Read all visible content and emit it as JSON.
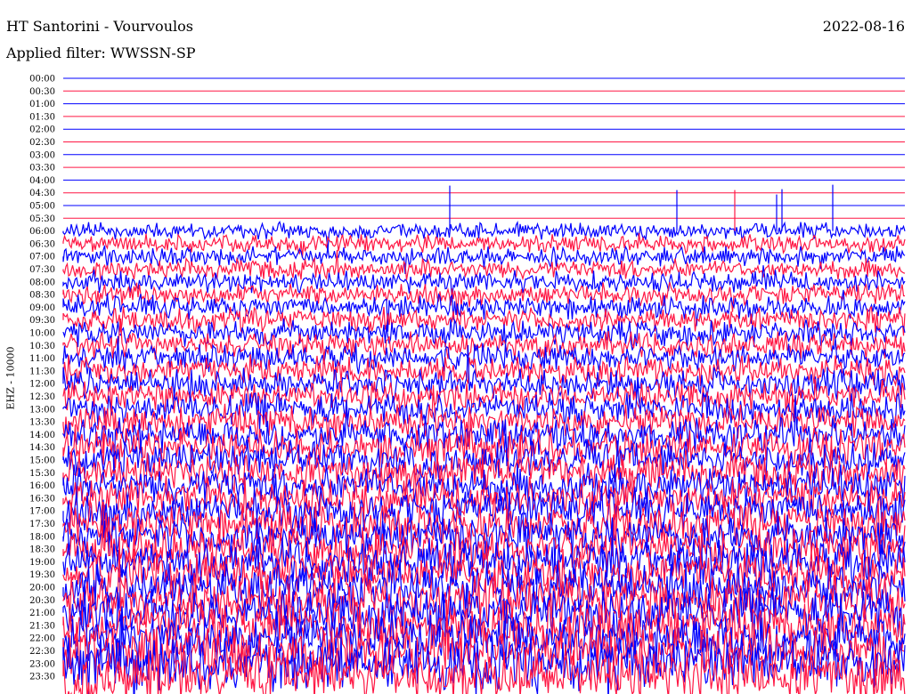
{
  "header": {
    "station": "HT Santorini - Vourvoulos",
    "date": "2022-08-16",
    "filter": "Applied filter: WWSSN-SP"
  },
  "chart_data": {
    "type": "line",
    "title": "HT Santorini - Vourvoulos",
    "ylabel": "EHZ - 10000",
    "row_labels": [
      "00:00",
      "00:30",
      "01:00",
      "01:30",
      "02:00",
      "02:30",
      "03:00",
      "03:30",
      "04:00",
      "04:30",
      "05:00",
      "05:30",
      "06:00",
      "06:30",
      "07:00",
      "07:30",
      "08:00",
      "08:30",
      "09:00",
      "09:30",
      "10:00",
      "10:30",
      "11:00",
      "11:30",
      "12:00",
      "12:30",
      "13:00",
      "13:30",
      "14:00",
      "14:30",
      "15:00",
      "15:30",
      "16:00",
      "16:30",
      "17:00",
      "17:30",
      "18:00",
      "18:30",
      "19:00",
      "19:30",
      "20:00",
      "20:30",
      "21:00",
      "21:30",
      "22:00",
      "22:30",
      "23:00",
      "23:30"
    ],
    "colors": [
      "#0000ff",
      "#ff1744"
    ],
    "recording_starts_row": 12,
    "amplitude_level": "trace amplitude saturates rows after 06:00; flat baseline lines 00:00-05:30",
    "grid": false
  }
}
